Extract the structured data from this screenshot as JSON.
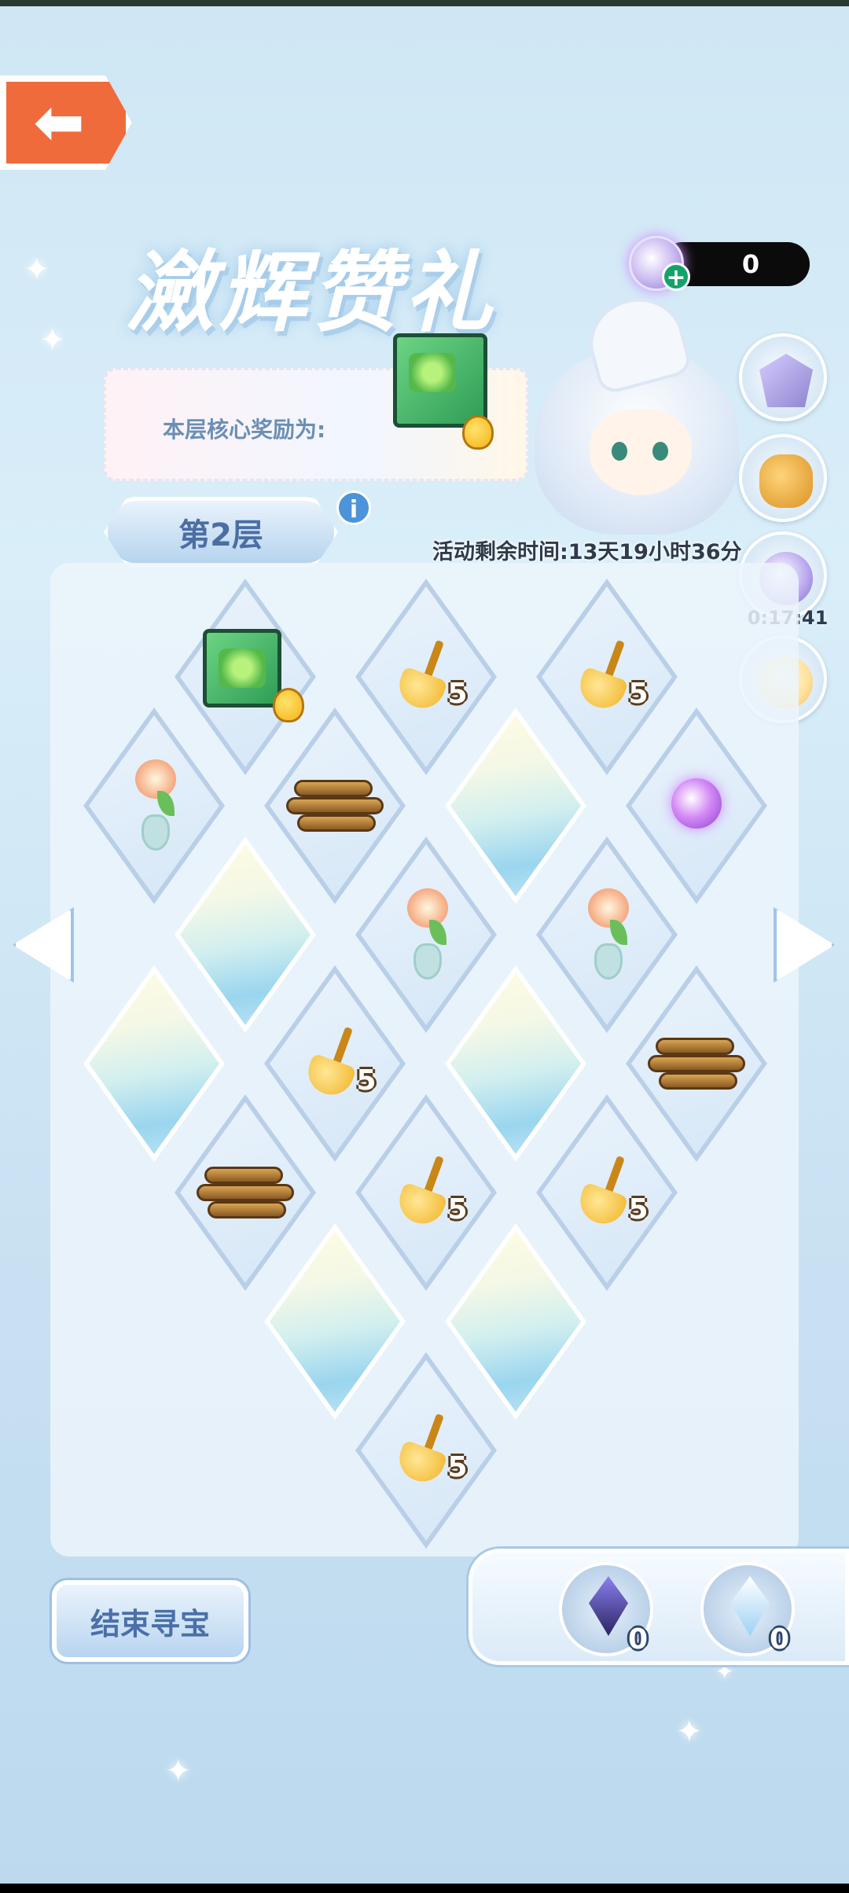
{
  "screen": {
    "title": "瀲辉赞礼",
    "back_label": "back"
  },
  "currency": {
    "value": "0",
    "plus_label": "+",
    "icon": "purple-orb-icon"
  },
  "core_reward": {
    "label": "本层核心奖励为:",
    "item_icon": "green-crate-icon"
  },
  "floor": {
    "label": "第2层",
    "info_label": "i"
  },
  "event_timer": {
    "text": "活动剩余时间:13天19小时36分"
  },
  "side_buttons": [
    {
      "icon": "purple-crystal-icon"
    },
    {
      "icon": "golden-treasure-icon"
    },
    {
      "icon": "orb-timer-icon",
      "timer": "0:17:41"
    },
    {
      "icon": "magnifier-chick-icon"
    }
  ],
  "board": {
    "cells": [
      {
        "item": "crate"
      },
      {
        "item": "broom",
        "qty": "5"
      },
      {
        "item": "broom",
        "qty": "5"
      },
      {
        "item": "flower"
      },
      {
        "item": "wood"
      },
      {
        "item": "crystal"
      },
      {
        "item": "orb"
      },
      {
        "item": "crystal"
      },
      {
        "item": "flower"
      },
      {
        "item": "flower"
      },
      {
        "item": "crystal"
      },
      {
        "item": "broom",
        "qty": "5"
      },
      {
        "item": "crystal"
      },
      {
        "item": "wood"
      },
      {
        "item": "wood"
      },
      {
        "item": "broom",
        "qty": "5"
      },
      {
        "item": "broom",
        "qty": "5"
      },
      {
        "item": "crystal"
      },
      {
        "item": "crystal"
      },
      {
        "item": "broom",
        "qty": "5"
      }
    ]
  },
  "end_button": {
    "label": "结束寻宝"
  },
  "tray": {
    "items": [
      {
        "icon": "dark-crystal-icon",
        "count": "0"
      },
      {
        "icon": "light-crystal-icon",
        "count": "0"
      }
    ]
  }
}
